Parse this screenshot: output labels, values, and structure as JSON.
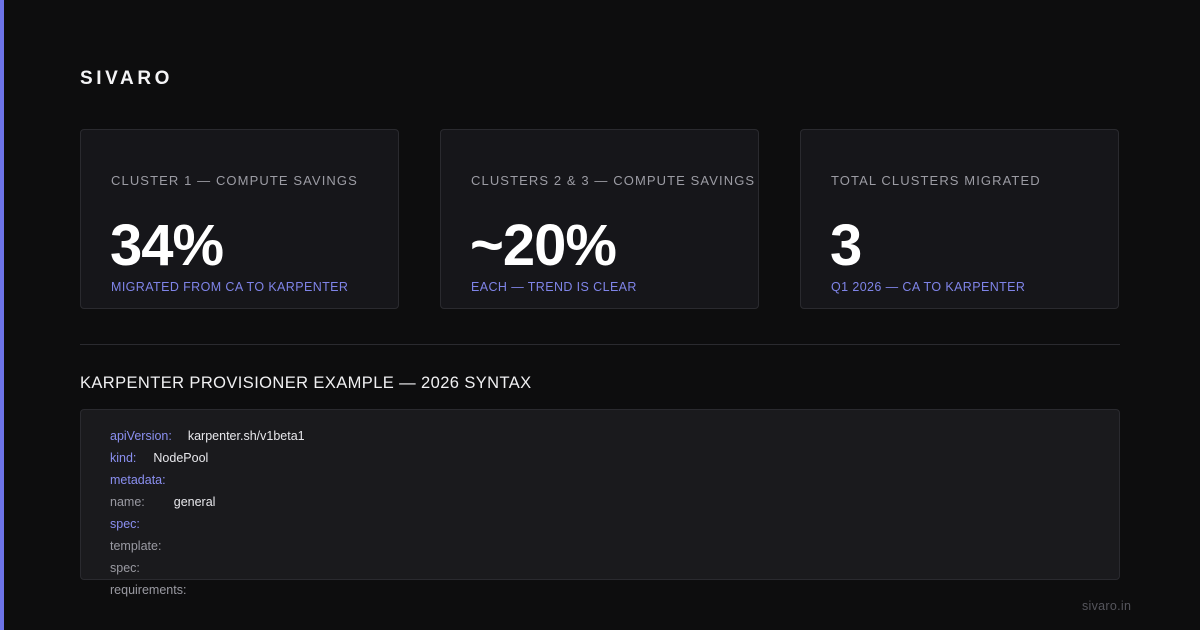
{
  "brand": "SIVARO",
  "accent_color": "#6d73e8",
  "stats": [
    {
      "label": "CLUSTER 1 — COMPUTE SAVINGS",
      "value": "34%",
      "sub": "MIGRATED FROM CA TO KARPENTER"
    },
    {
      "label": "CLUSTERS 2 & 3 — COMPUTE SAVINGS",
      "value": "~20%",
      "sub": "EACH — TREND IS CLEAR"
    },
    {
      "label": "TOTAL CLUSTERS MIGRATED",
      "value": "3",
      "sub": "Q1 2026 — CA TO KARPENTER"
    }
  ],
  "section_title": "KARPENTER PROVISIONER EXAMPLE — 2026 SYNTAX",
  "code": [
    {
      "key": "apiVersion:",
      "value": "karpenter.sh/v1beta1"
    },
    {
      "key": "kind:",
      "value": "NodePool"
    },
    {
      "key": "metadata:",
      "value": ""
    },
    {
      "key": "name:",
      "value": "general"
    },
    {
      "key": "spec:",
      "value": ""
    },
    {
      "key": "template:",
      "value": ""
    },
    {
      "key": "spec:",
      "value": ""
    },
    {
      "key": "requirements:",
      "value": ""
    }
  ],
  "footer_url": "sivaro.in"
}
